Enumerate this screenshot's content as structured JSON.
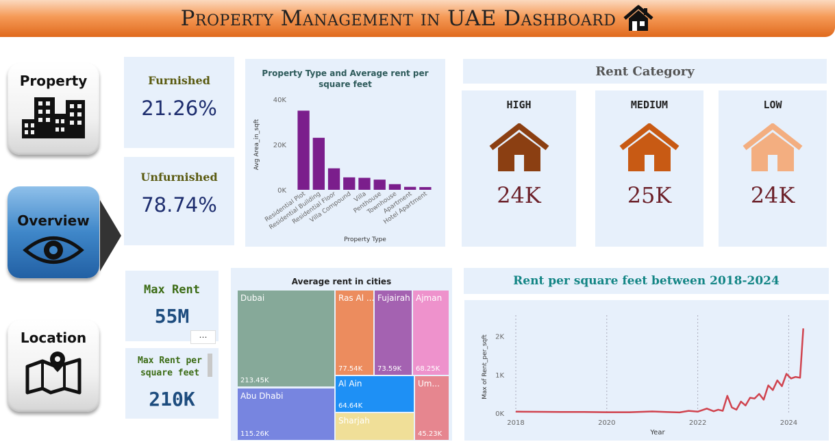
{
  "header": {
    "title": "Property Management in UAE Dashboard",
    "icon": "house-icon"
  },
  "nav": {
    "property": {
      "label": "Property",
      "icon": "buildings-icon"
    },
    "overview": {
      "label": "Overview",
      "icon": "eye-icon"
    },
    "location": {
      "label": "Location",
      "icon": "map-pin-icon"
    }
  },
  "kpis": {
    "furnished": {
      "label": "Furnished",
      "value": "21.26%"
    },
    "unfurnished": {
      "label": "Unfurnished",
      "value": "78.74%"
    },
    "max_rent": {
      "label": "Max Rent",
      "value": "55M"
    },
    "max_rent_sqft": {
      "label": "Max Rent per square feet",
      "value": "210K"
    }
  },
  "rent_category": {
    "title": "Rent Category",
    "items": [
      {
        "label": "HIGH",
        "value": "24K",
        "color": "#8b3f12"
      },
      {
        "label": "MEDIUM",
        "value": "25K",
        "color": "#c85a14"
      },
      {
        "label": "LOW",
        "value": "24K",
        "color": "#f3ae80"
      }
    ]
  },
  "chart_data": [
    {
      "type": "bar",
      "title": "Property Type and Average rent per square feet",
      "xlabel": "Property Type",
      "ylabel": "Avg Area_in_sqft",
      "categories": [
        "Residential Plot",
        "Residential Building",
        "Residential Floor",
        "Villa Compound",
        "Villa",
        "Penthouse",
        "Townhouse",
        "Apartment",
        "Hotel Apartment"
      ],
      "values": [
        35000,
        23000,
        9500,
        5500,
        5300,
        4500,
        2500,
        1300,
        1200
      ],
      "ylim": [
        0,
        40000
      ],
      "yticks": [
        "0K",
        "20K",
        "40K"
      ],
      "color": "#7b1e8c"
    },
    {
      "type": "treemap",
      "title": "Average rent in cities",
      "items": [
        {
          "name": "Dubai",
          "value": "213.45K",
          "color": "#86a999"
        },
        {
          "name": "Abu Dhabi",
          "value": "115.26K",
          "color": "#7785e0"
        },
        {
          "name": "Ras Al ...",
          "value": "77.54K",
          "color": "#ec8c5e"
        },
        {
          "name": "Fujairah",
          "value": "73.59K",
          "color": "#a462b1"
        },
        {
          "name": "Ajman",
          "value": "68.25K",
          "color": "#ee92cc"
        },
        {
          "name": "Al Ain",
          "value": "64.64K",
          "color": "#1e90f5"
        },
        {
          "name": "Sharjah",
          "value": "",
          "color": "#f0df98"
        },
        {
          "name": "Um...",
          "value": "45.23K",
          "color": "#e6868f"
        }
      ]
    },
    {
      "type": "line",
      "title": "Rent per square feet between 2018-2024",
      "xlabel": "Year",
      "ylabel": "Max of Rent_per_sqft",
      "xticks": [
        "2018",
        "2020",
        "2022",
        "2024"
      ],
      "yticks": [
        "0K",
        "1K",
        "2K"
      ],
      "xlim": [
        2018,
        2024.4
      ],
      "ylim": [
        0,
        2400
      ],
      "color": "#d0434e",
      "x": [
        2018.0,
        2018.5,
        2019.0,
        2019.5,
        2020.0,
        2020.5,
        2021.0,
        2021.3,
        2021.6,
        2021.8,
        2022.0,
        2022.2,
        2022.35,
        2022.45,
        2022.55,
        2022.65,
        2022.75,
        2022.85,
        2022.95,
        2023.05,
        2023.15,
        2023.25,
        2023.35,
        2023.45,
        2023.55,
        2023.65,
        2023.75,
        2023.85,
        2023.95,
        2024.05,
        2024.15,
        2024.25,
        2024.32
      ],
      "y": [
        40,
        35,
        30,
        30,
        25,
        25,
        45,
        30,
        20,
        60,
        40,
        120,
        50,
        90,
        60,
        450,
        150,
        90,
        300,
        200,
        400,
        380,
        500,
        350,
        720,
        600,
        850,
        700,
        1020,
        900,
        940,
        920,
        2200
      ]
    }
  ]
}
